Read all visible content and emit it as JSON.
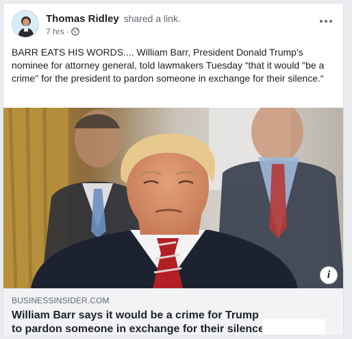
{
  "post": {
    "author": "Thomas Ridley",
    "action": "shared a link.",
    "time": "7 hrs",
    "separator": "·",
    "privacy_icon": "globe-icon",
    "more_icon": "more-horizontal-icon",
    "text": "BARR EATS HIS WORDS....  William Barr, President Donald Trump's nominee for attorney general, told lawmakers Tuesday “that it would \"be a crime\" for the president to pardon someone in exchange for their silence.“"
  },
  "link": {
    "domain": "BUSINESSINSIDER.COM",
    "headline": "William Barr says it would be a crime for Trump to pardon someone in exchange for their silence",
    "info_icon": "info-icon",
    "info_label": "i"
  },
  "colors": {
    "author": "#1c1e21",
    "secondary": "#606770",
    "link_bg": "#f2f3f5",
    "card_border": "#dddfe2"
  }
}
